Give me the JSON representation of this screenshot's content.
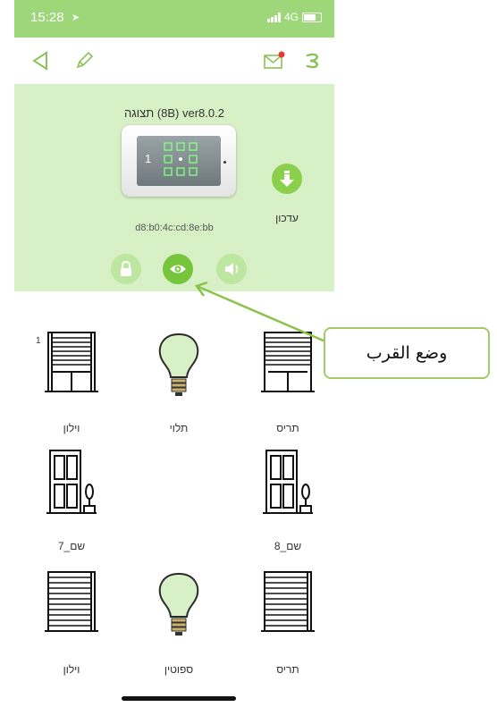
{
  "status_bar": {
    "time": "15:28",
    "network": "4G"
  },
  "device": {
    "version_text": "תצוגה (8B) ver8.0.2",
    "mac": "d8:b0:4c:cd:8e:bb",
    "keypad_number": "1",
    "update_label": "עדכון"
  },
  "modes": [
    {
      "name": "lock",
      "icon": "lock-icon",
      "active": false
    },
    {
      "name": "proximity",
      "icon": "eye-icon",
      "active": true
    },
    {
      "name": "sound",
      "icon": "speaker-icon",
      "active": false
    }
  ],
  "callout": {
    "text": "وضع القرب"
  },
  "tiles": [
    {
      "label": "וילון",
      "icon": "window-blind-icon",
      "badge": "1"
    },
    {
      "label": "תלוי",
      "icon": "lightbulb-icon",
      "badge": ""
    },
    {
      "label": "תריס",
      "icon": "window-shutter-icon",
      "badge": ""
    },
    {
      "label": "שם_7",
      "icon": "door-icon",
      "badge": ""
    },
    {
      "label": "שם_8",
      "icon": "door-icon",
      "badge": ""
    },
    {
      "label": "וילון",
      "icon": "window-blind-icon",
      "badge": ""
    },
    {
      "label": "ספוטין",
      "icon": "lightbulb-icon",
      "badge": ""
    },
    {
      "label": "תריס",
      "icon": "window-shutter-icon",
      "badge": ""
    }
  ],
  "colors": {
    "accent": "#77c53c",
    "panel": "#d8f0c6",
    "status_bar": "#9ed77a",
    "callout_border": "#a6c86a"
  }
}
